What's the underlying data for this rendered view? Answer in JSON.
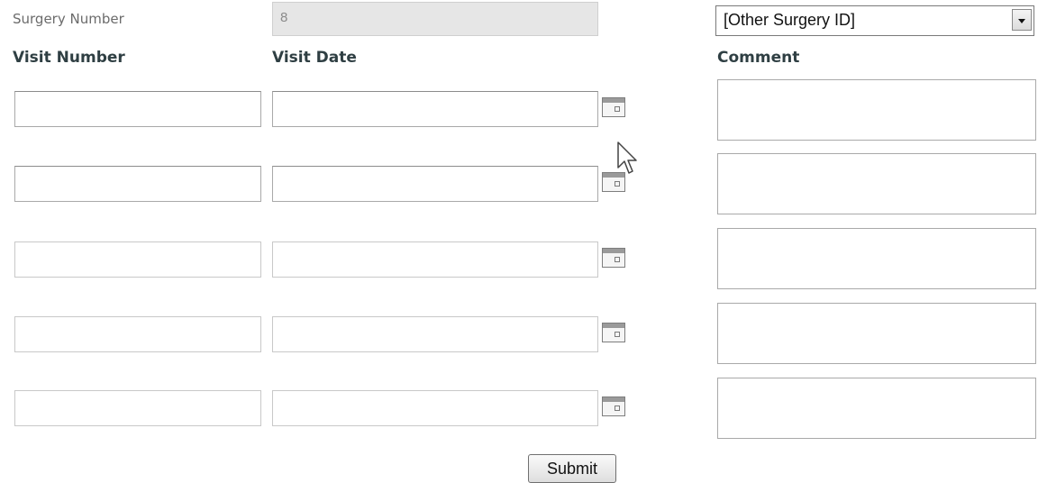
{
  "surgery": {
    "label": "Surgery Number",
    "value": "8",
    "other_select": {
      "selected": "[Other Surgery ID]",
      "arrow_icon": "chevron-down-icon"
    }
  },
  "columns": {
    "visit_number": "Visit Number",
    "visit_date": "Visit Date",
    "comment": "Comment"
  },
  "rows": [
    {
      "visit_number": "",
      "visit_date": "",
      "comment": ""
    },
    {
      "visit_number": "",
      "visit_date": "",
      "comment": ""
    },
    {
      "visit_number": "",
      "visit_date": "",
      "comment": ""
    },
    {
      "visit_number": "",
      "visit_date": "",
      "comment": ""
    },
    {
      "visit_number": "",
      "visit_date": "",
      "comment": ""
    }
  ],
  "icons": {
    "calendar": "calendar-icon",
    "pointer": "mouse-pointer-icon"
  },
  "submit_label": "Submit"
}
